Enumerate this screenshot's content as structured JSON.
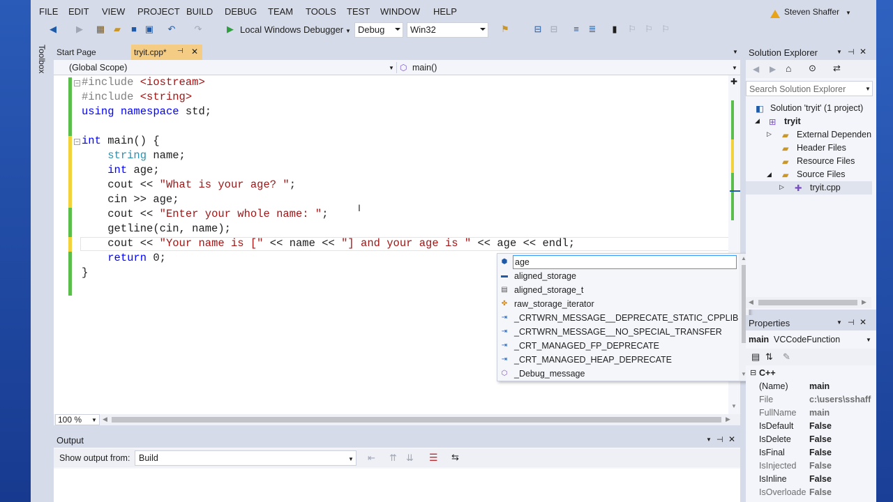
{
  "menu": [
    "FILE",
    "EDIT",
    "VIEW",
    "PROJECT",
    "BUILD",
    "DEBUG",
    "TEAM",
    "TOOLS",
    "TEST",
    "WINDOW",
    "HELP"
  ],
  "user": "Steven Shaffer",
  "toolbar": {
    "debugger_label": "Local Windows Debugger",
    "config": "Debug",
    "platform": "Win32"
  },
  "toolbox_label": "Toolbox",
  "tabs": {
    "start_page": "Start Page",
    "active": "tryit.cpp*"
  },
  "nav": {
    "scope": "(Global Scope)",
    "member": "main()"
  },
  "code": {
    "l1_pp": "#include",
    "l1_str": "<iostream>",
    "l2_pp": "#include",
    "l2_str": "<string>",
    "l3_kw1": "using",
    "l3_kw2": "namespace",
    "l3_tx": "std;",
    "l5_kw": "int",
    "l5_tx": "main() {",
    "l6_ty": "string",
    "l6_tx": "name;",
    "l7_kw": "int",
    "l7_tx": "age;",
    "l8_tx": "cout <<",
    "l8_str": "\"What is your age? \"",
    "l8_end": ";",
    "l9_tx": "cin >> age;",
    "l10_tx": "cout <<",
    "l10_str": "\"Enter your whole name: \"",
    "l10_end": ";",
    "l11_tx": "getline(cin, name);",
    "l12_tx1": "cout <<",
    "l12_str1": "\"Your name is [\"",
    "l12_tx2": "<< name <<",
    "l12_str2": "\"] and your age is \"",
    "l12_tx3": "<< age << endl;",
    "l13_kw": "return",
    "l13_tx": "0;",
    "l14_tx": "}"
  },
  "zoom": "100 %",
  "intellisense": {
    "selected": "age",
    "items": [
      {
        "label": "aligned_storage",
        "icon": "class-icon"
      },
      {
        "label": "aligned_storage_t",
        "icon": "typedef-icon"
      },
      {
        "label": "raw_storage_iterator",
        "icon": "class-template-icon"
      },
      {
        "label": "_CRTWRN_MESSAGE__DEPRECATE_STATIC_CPPLIB",
        "icon": "macro-icon"
      },
      {
        "label": "_CRTWRN_MESSAGE__NO_SPECIAL_TRANSFER",
        "icon": "macro-icon"
      },
      {
        "label": "_CRT_MANAGED_FP_DEPRECATE",
        "icon": "macro-icon"
      },
      {
        "label": "_CRT_MANAGED_HEAP_DEPRECATE",
        "icon": "macro-icon"
      },
      {
        "label": "_Debug_message",
        "icon": "function-icon"
      }
    ]
  },
  "solution_explorer": {
    "title": "Solution Explorer",
    "search_placeholder": "Search Solution Explorer",
    "solution": "Solution 'tryit' (1 project)",
    "project": "tryit",
    "folders": [
      "External Dependen",
      "Header Files",
      "Resource Files",
      "Source Files"
    ],
    "file": "tryit.cpp"
  },
  "properties": {
    "title": "Properties",
    "object": "main",
    "object_type": "VCCodeFunction",
    "category": "C++",
    "rows": [
      {
        "name": "(Name)",
        "value": "main"
      },
      {
        "name": "File",
        "value": "c:\\users\\sshaff"
      },
      {
        "name": "FullName",
        "value": "main"
      },
      {
        "name": "IsDefault",
        "value": "False"
      },
      {
        "name": "IsDelete",
        "value": "False"
      },
      {
        "name": "IsFinal",
        "value": "False"
      },
      {
        "name": "IsInjected",
        "value": "False"
      },
      {
        "name": "IsInline",
        "value": "False"
      },
      {
        "name": "IsOverloade",
        "value": "False"
      }
    ]
  },
  "output": {
    "title": "Output",
    "show_from_label": "Show output from:",
    "source": "Build"
  },
  "colors": {
    "accent_tab": "#f5cc84",
    "change_saved": "#5bbd4c",
    "change_unsaved": "#f2d23c",
    "keyword": "#0000ff",
    "type": "#2b91af",
    "string": "#a31515"
  }
}
